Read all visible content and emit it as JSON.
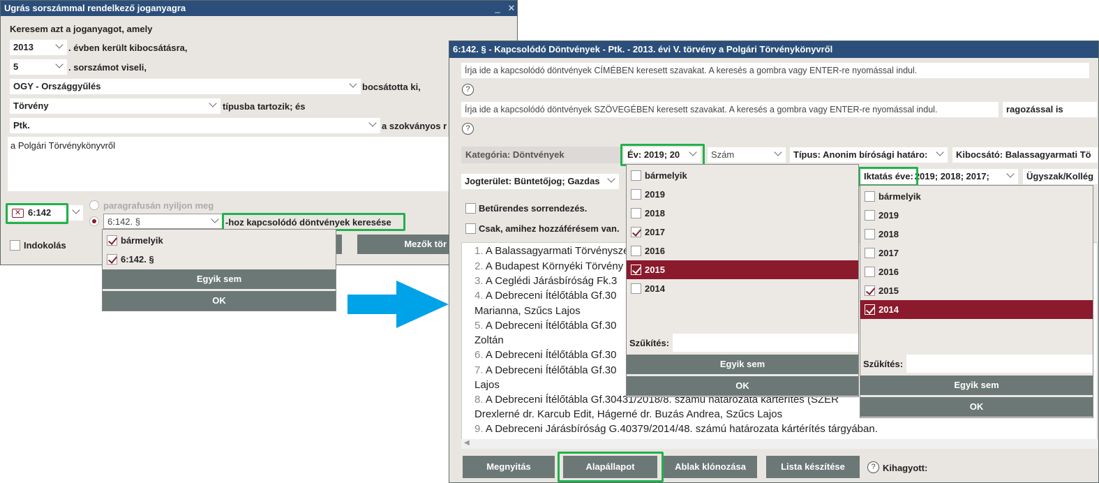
{
  "left": {
    "title": "Ugrás sorszámmal rendelkező joganyagra",
    "minimize": "_",
    "close": "✕",
    "intro": "Keresem azt a joganyagot, amely",
    "year_value": "2013",
    "year_suffix": ". évben került kibocsátásra,",
    "number_value": "5",
    "number_suffix": ". sorszámot viseli,",
    "issuer_value": "OGY - Országgyűlés",
    "issuer_suffix": "bocsátotta ki,",
    "type_value": "Törvény",
    "type_suffix": "típusba tartozik; és",
    "short_value": "Ptk.",
    "short_suffix": "a szokványos r",
    "long_title": "a Polgári Törvénykönyvről",
    "section_value": "6:142",
    "radio1_label": "paragrafusán nyiljon meg",
    "paragraph_value": "6:142. §",
    "search_related_label": "-hoz kapcsolódó döntvények keresése",
    "indokolas_label": "Indokolás",
    "fields_button": "Mezők tör",
    "dropdown": {
      "items": [
        "bármelyik",
        "6:142. §"
      ],
      "none_button": "Egyik sem",
      "ok_button": "OK"
    }
  },
  "right": {
    "title": "6:142. § - Kapcsolódó Döntvények - Ptk. - 2013. évi V. törvény a Polgári Törvénykönyvről",
    "search_title_placeholder": "Írja ide a kapcsolódó döntvények CÍMÉBEN keresett szavakat. A keresés a gombra vagy ENTER-re nyomással indul.",
    "search_text_placeholder": "Írja ide a kapcsolódó döntvények SZÖVEGÉBEN keresett szavakat. A keresés a gombra vagy ENTER-re nyomással indul.",
    "inflection_label": "ragozással is",
    "help_glyph": "?",
    "category_label": "Kategória: Döntvények",
    "year_filter": "Év: 2019; 20",
    "number_filter": "Szám",
    "type_filter": "Típus: Anonim bírósági határo:",
    "issuer_filter": "Kibocsátó: Balassagyarmati Tö",
    "legal_area_filter": "Jogterület: Büntetőjog; Gazdas",
    "filing_year_filter_label": "Iktatás éve:",
    "filing_year_filter_value": "2019; 2018; 2017;",
    "case_type_filter": "Ügyszak/Kollég",
    "alphabetical_label": "Betűrendes sorrendezés.",
    "accessible_label": "Csak, amihez hozzáférésem van.",
    "results": [
      {
        "num": "1.",
        "text": "A Balassagyarmati Törvényszé"
      },
      {
        "num": "2.",
        "text": "A Budapest Környéki Törvény"
      },
      {
        "num": "3.",
        "text": "A Ceglédi Járásbíróság Fk.3"
      },
      {
        "num": "4.",
        "text": "A Debreceni Ítélőtábla Gf.30"
      },
      {
        "num": "",
        "text": "Marianna, Szűcs Lajos"
      },
      {
        "num": "5.",
        "text": "A Debreceni Ítélőtábla Gf.30"
      },
      {
        "num": "",
        "text": "Zoltán"
      },
      {
        "num": "6.",
        "text": "A Debreceni Ítélőtábla Gf.30"
      },
      {
        "num": "7.",
        "text": "A Debreceni Ítélőtábla Gf.30"
      },
      {
        "num": "",
        "text": "Lajos"
      },
      {
        "num": "8.",
        "text": "A Debreceni Ítélőtábla Gf.30431/2018/8. számú határozata kártérítés (SZER"
      },
      {
        "num": "",
        "text": "Drexlerné dr. Karcub Edit, Hágerné dr. Buzás Andrea, Szűcs Lajos"
      },
      {
        "num": "9.",
        "text": "A Debreceni Járásbíróság G.40379/2014/48. számú határozata kártérítés tárgyában."
      }
    ],
    "year_dropdown": {
      "items": [
        {
          "label": "bármelyik",
          "checked": false
        },
        {
          "label": "2019",
          "checked": false
        },
        {
          "label": "2018",
          "checked": false
        },
        {
          "label": "2017",
          "checked": true
        },
        {
          "label": "2016",
          "checked": false
        },
        {
          "label": "2015",
          "checked": true
        },
        {
          "label": "2014",
          "checked": false
        }
      ],
      "narrow_label": "Szűkítés:",
      "none_button": "Egyik sem",
      "ok_button": "OK"
    },
    "filing_dropdown": {
      "items": [
        {
          "label": "bármelyik",
          "checked": false
        },
        {
          "label": "2019",
          "checked": false
        },
        {
          "label": "2018",
          "checked": false
        },
        {
          "label": "2017",
          "checked": false
        },
        {
          "label": "2016",
          "checked": false
        },
        {
          "label": "2015",
          "checked": true
        },
        {
          "label": "2014",
          "checked": true
        }
      ],
      "narrow_label": "Szűkítés:",
      "none_button": "Egyik sem",
      "ok_button": "OK"
    },
    "buttons": {
      "open": "Megnyitás",
      "reset": "Alapállapot",
      "clone": "Ablak klónozása",
      "list": "Lista készítése"
    },
    "skipped_label": "Kihagyott:"
  },
  "colors": {
    "title_bar": "#2b4f7a",
    "selected": "#8b1a2c",
    "highlight": "#22b14c",
    "arrow": "#00a2e8",
    "button": "#6b7876"
  }
}
